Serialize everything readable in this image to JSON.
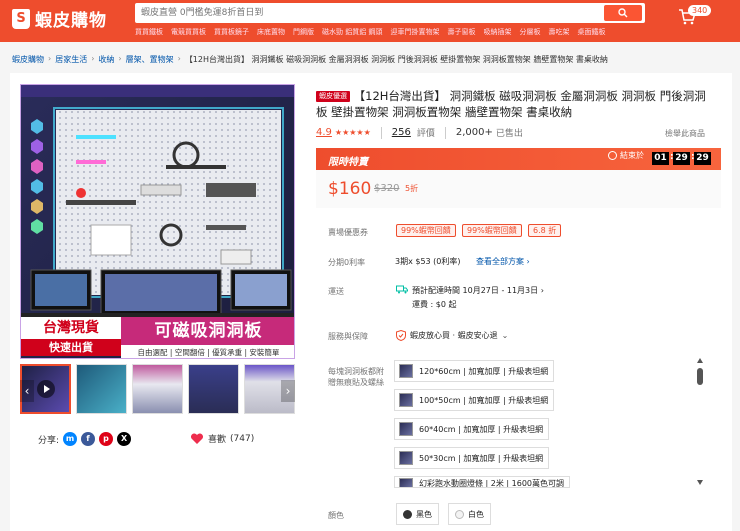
{
  "header": {
    "logo_text": "蝦皮購物",
    "search_placeholder": "蝦皮直營 0門檻免運8折首日到",
    "hot_keywords": [
      "買買鐵板",
      "電競買買板",
      "買買板鏡子",
      "床底置物",
      "門鋼版",
      "磁水勁 鋁質鋁 鋼頭",
      "迎車門掛置物架",
      "壽子窗板",
      "吸納插架",
      "分層板",
      "壽吃架",
      "桌面鐵板"
    ],
    "cart_count": "340"
  },
  "breadcrumb": [
    "蝦皮購物",
    "居家生活",
    "收納",
    "層架、置物架",
    "【12H台灣出貨】 洞洞鐵板 磁吸洞洞板 金屬洞洞板 洞洞板 門後洞洞板 壁掛置物架 洞洞板置物架 牆壁置物架 書桌收納"
  ],
  "product": {
    "badge": "蝦皮優選",
    "title": "【12H台灣出貨】 洞洞鐵板 磁吸洞洞板 金屬洞洞板 洞洞板 門後洞洞板 壁掛置物架 洞洞板置物架 牆壁置物架 書桌收納",
    "rating": "4.9",
    "stars": "★★★★★",
    "review_count": "256",
    "review_label": "評價",
    "sold_count": "2,000+",
    "sold_label": "已售出",
    "report": "檢舉此商品"
  },
  "image_banner": {
    "tag_line1": "台灣現貨",
    "tag_line2": "快速出貨",
    "headline": "可磁吸洞洞板",
    "features": "自由選配 | 空間翻倍 | 優質承重 | 安裝簡單"
  },
  "flash_sale": {
    "title": "限時特賣",
    "ends_label": "結束於",
    "hours": "01",
    "minutes": "29",
    "seconds": "29",
    "price": "$160",
    "original_price": "$320",
    "discount": "5折"
  },
  "coupons": {
    "label": "賣場優惠券",
    "items": [
      "99%蝦幣回饋",
      "99%蝦幣回饋",
      "6.8 折"
    ]
  },
  "installment": {
    "label": "分期0利率",
    "text": "3期x $53 (0利率)",
    "link": "查看全部方案"
  },
  "shipping": {
    "label": "運送",
    "line1": "預計配達時間 10月27日 - 11月3日",
    "line2": "運費 : $0 起"
  },
  "guarantee": {
    "label": "服務與保障",
    "text": "蝦皮放心買 · 蝦皮安心退"
  },
  "variants": {
    "label": "每塊洞洞板都附贈無痕貼及螺絲",
    "options": [
      "120*60cm | 加寬加厚 | 升級表坦網",
      "100*50cm | 加寬加厚 | 升級表坦網",
      "60*40cm | 加寬加厚 | 升級表坦網",
      "50*30cm | 加寬加厚 | 升級表坦網",
      "幻彩跑水動圈燈條 | 2米 | 1600萬色可調"
    ]
  },
  "color": {
    "label": "顏色",
    "options": [
      "黑色",
      "白色"
    ]
  },
  "social": {
    "share_label": "分享:",
    "like_label": "喜歡",
    "like_count": "(747)"
  },
  "colors": {
    "brand": "#ee4d2d",
    "link": "#0055aa"
  }
}
